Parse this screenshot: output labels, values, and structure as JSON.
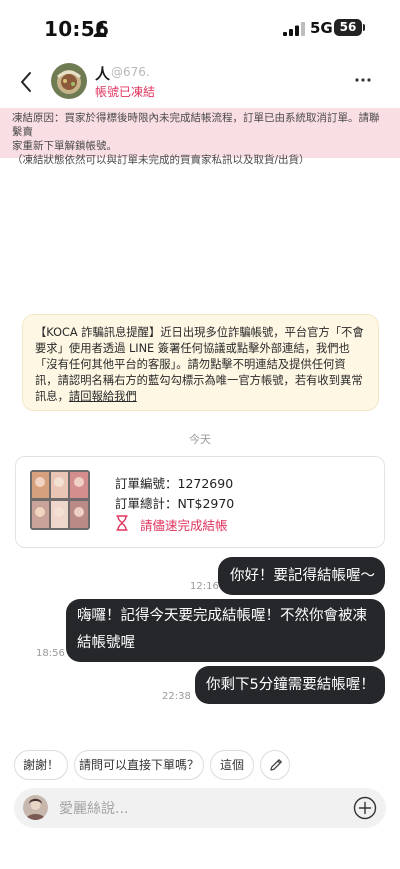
{
  "status_bar": {
    "time": "10:56",
    "network": "5G",
    "battery": "56",
    "icons": [
      "person-icon",
      "signal-icon"
    ]
  },
  "header": {
    "name": "人",
    "handle": "@676.",
    "status": "帳號已凍結",
    "icons": [
      "back-icon",
      "avatar",
      "more-icon"
    ]
  },
  "frozen_banner": {
    "line1": "凍結原因：買家於得標後時限內未完成結帳流程，訂單已由系統取消訂單。請聯繫賣",
    "line2": "家重新下單解鎖帳號。",
    "line3": "（凍結狀態依然可以與訂單未完成的買賣家私訊以及取貨/出貨）"
  },
  "notice": {
    "text": "【KOCA 詐騙訊息提醒】近日出現多位詐騙帳號，平台官方「不會要求」使用者透過 LINE 簽署任何協議或點擊外部連結，我們也「沒有任何其他平台的客服」。請勿點擊不明連結及提供任何資訊，請認明名稱右方的藍勾勾標示為唯一官方帳號，若有收到異常訊息，",
    "link": "請回報給我們"
  },
  "date_divider": "今天",
  "order": {
    "number": "訂單編號：1272690",
    "total": "訂單總計：NT$2970",
    "action": "請儘速完成結帳",
    "icons": [
      "hourglass-icon"
    ]
  },
  "messages": [
    {
      "text": "你好！要記得結帳喔～",
      "time": "12:16"
    },
    {
      "text": "嗨囉！記得今天要完成結帳喔！不然你會被凍結帳號喔",
      "time": "18:56"
    },
    {
      "text": "你剩下5分鐘需要結帳喔！",
      "time": "22:38"
    }
  ],
  "quick_replies": [
    "謝謝！",
    "請問可以直接下單嗎？",
    "這個"
  ],
  "quick_reply_icons": [
    "pencil-icon"
  ],
  "input": {
    "placeholder": "愛麗絲說...",
    "icons": [
      "add-icon"
    ]
  },
  "colors": {
    "accent": "#e0355f",
    "banner_bg": "#f9dfe4",
    "notice_bg": "#fdf7e4",
    "bubble_bg": "#25272b"
  }
}
